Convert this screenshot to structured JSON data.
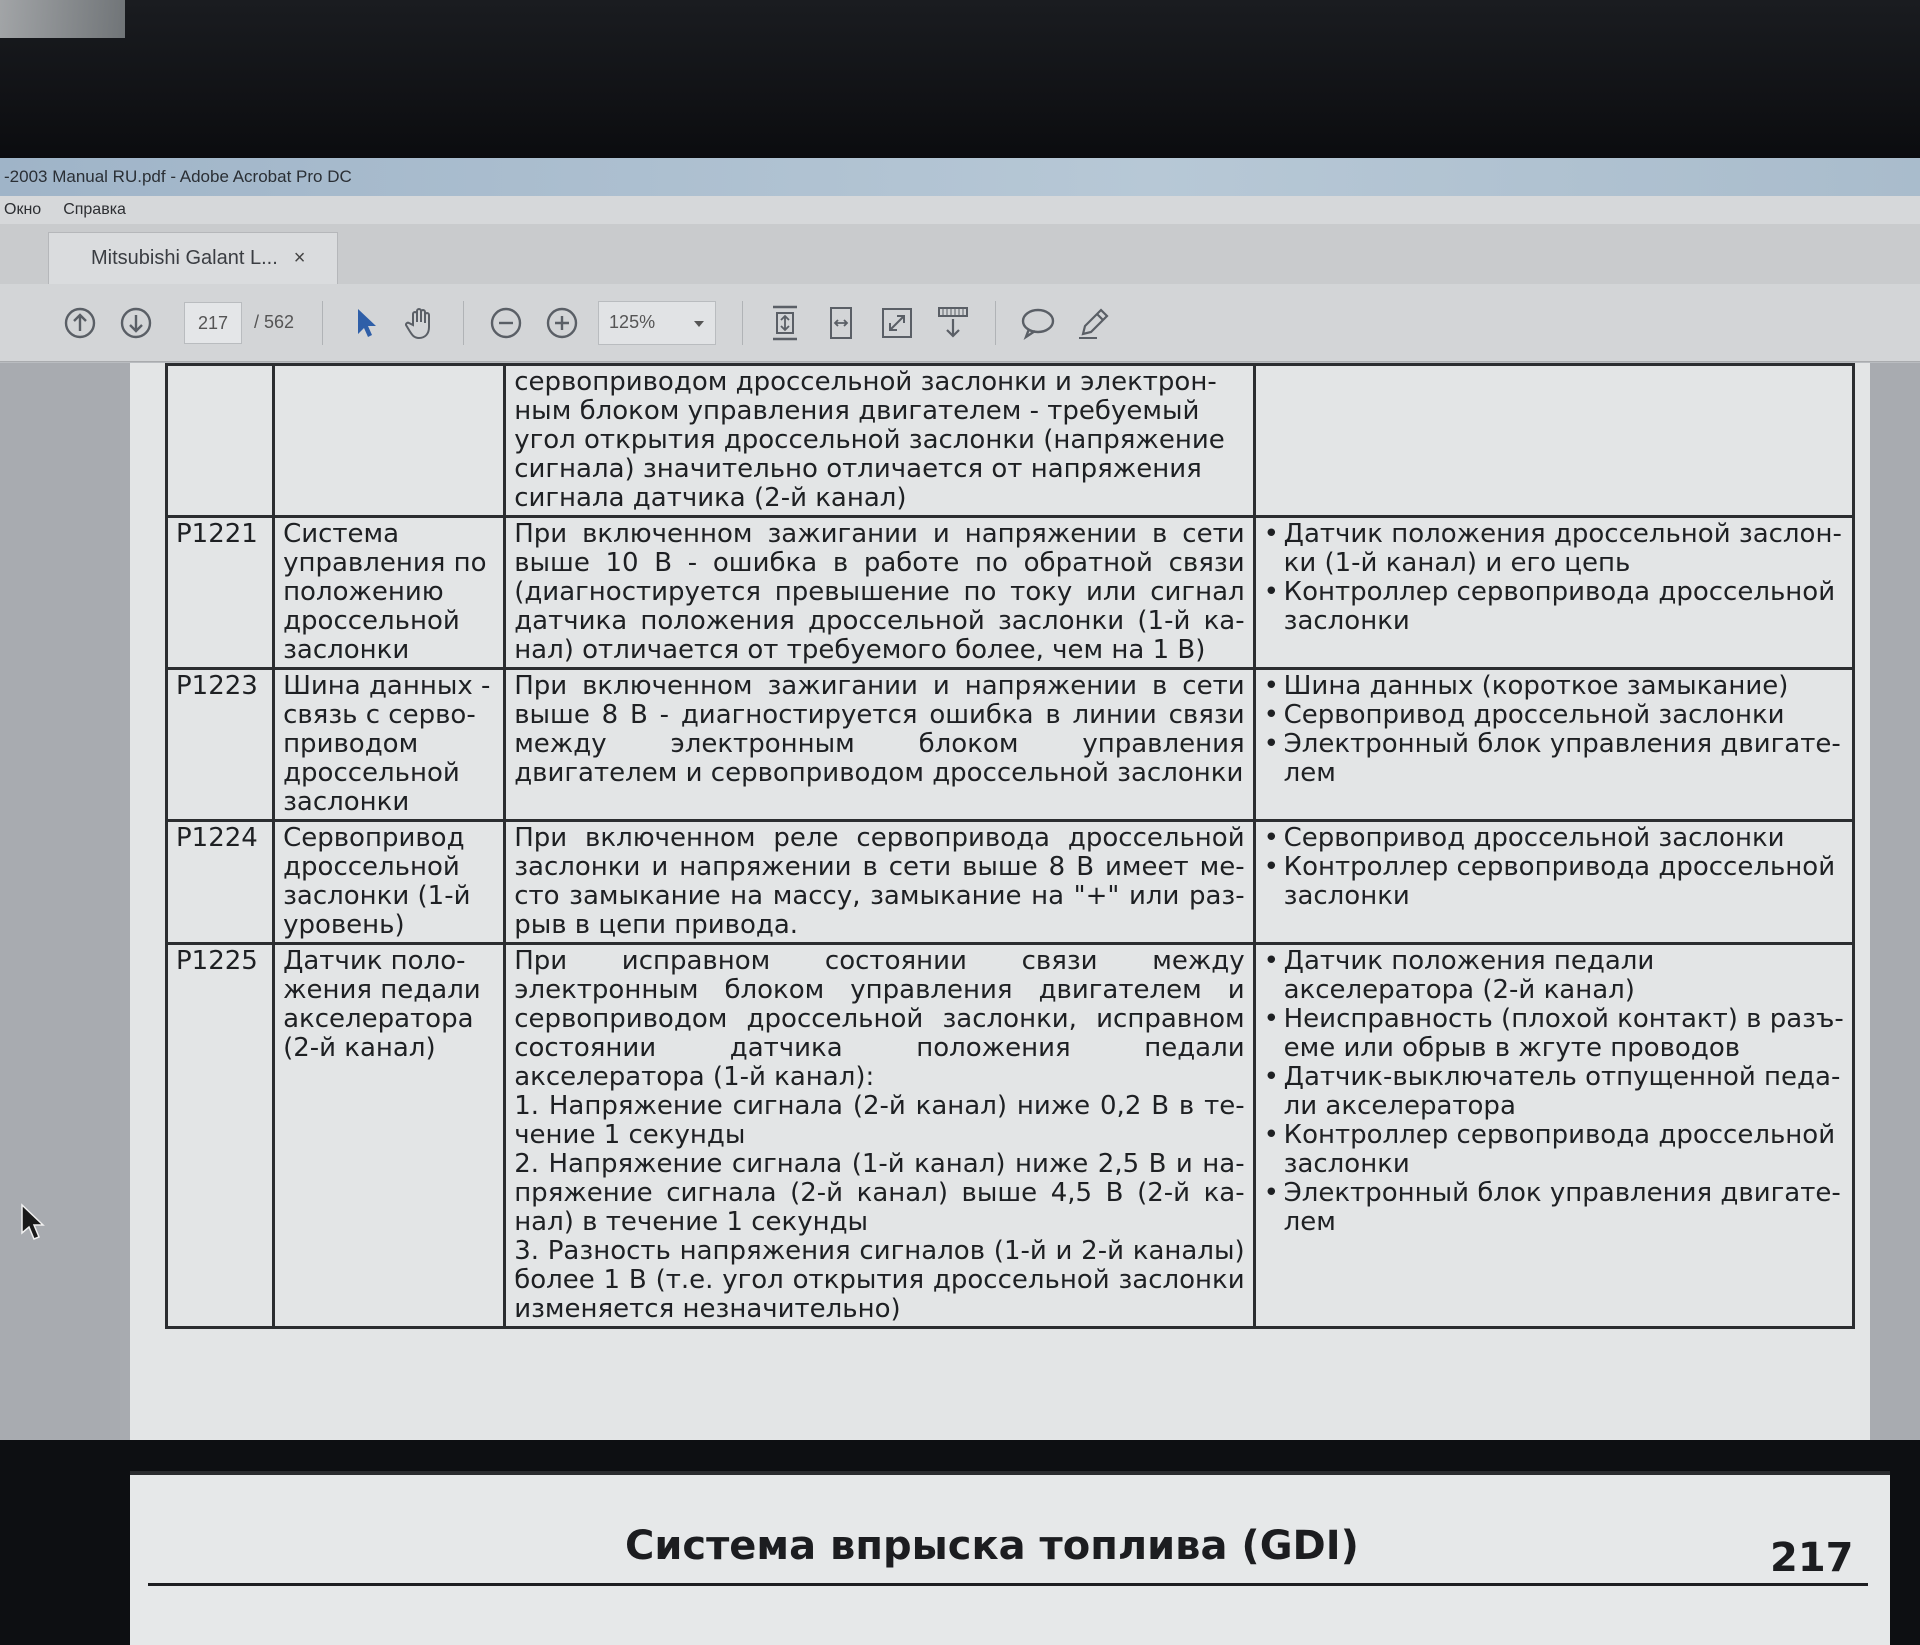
{
  "window": {
    "title": "-2003 Manual RU.pdf - Adobe Acrobat Pro DC"
  },
  "menu": {
    "items": [
      "Окно",
      "Справка"
    ]
  },
  "tab": {
    "label": "Mitsubishi Galant L...",
    "close": "×"
  },
  "toolbar": {
    "page_current": "217",
    "page_total": "/ 562",
    "zoom": "125%",
    "icons": [
      "arrow-up-circle-icon",
      "arrow-down-circle-icon",
      "select-arrow-icon",
      "hand-icon",
      "zoom-out-icon",
      "zoom-in-icon",
      "fit-page-icon",
      "fit-width-icon",
      "fullscreen-icon",
      "scroll-mode-icon",
      "comment-icon",
      "pen-icon"
    ]
  },
  "table": {
    "rows": [
      {
        "code": "",
        "name": "",
        "desc": [
          "сервоприводом дроссельной заслонки и электрон-",
          "ным блоком управления двигателем - требуемый",
          "угол открытия дроссельной заслонки (напряжение",
          "сигнала) значительно отличается от напряжения",
          "сигнала датчика (2-й канал)"
        ],
        "causes": []
      },
      {
        "code": "P1221",
        "name": "Система управления по положению дроссельной заслонки",
        "desc": [
          "При включенном зажигании и напряжении в сети выше 10 В - ошибка в работе по обратной связи (диагностируется превышение по току или сигнал датчика положения дроссельной заслонки (1-й ка-нал) отличается от требуемого более, чем на 1 В)"
        ],
        "causes": [
          "Датчик положения дроссельной заслон-ки (1-й канал) и его цепь",
          "Контроллер сервопривода дроссельной заслонки"
        ]
      },
      {
        "code": "P1223",
        "name": "Шина данных - связь с серво-приводом дроссельной заслонки",
        "desc": [
          "При включенном зажигании и напряжении в сети выше 8 В - диагностируется ошибка в линии связи между электронным блоком управления двигателем и сервоприводом дроссельной заслонки"
        ],
        "causes": [
          "Шина данных (короткое замыкание)",
          "Сервопривод дроссельной заслонки",
          "Электронный блок управления двигате-лем"
        ]
      },
      {
        "code": "P1224",
        "name": "Сервопривод дроссельной заслонки (1-й уровень)",
        "desc": [
          "При включенном реле сервопривода дроссельной заслонки и напряжении в сети выше 8 В имеет ме-сто замыкание на массу, замыкание на \"+\" или раз-рыв в цепи привода."
        ],
        "causes": [
          "Сервопривод дроссельной заслонки",
          "Контроллер сервопривода дроссельной заслонки"
        ]
      },
      {
        "code": "P1225",
        "name": "Датчик поло-жения педали акселератора (2-й канал)",
        "desc": [
          "При исправном состоянии связи между электронным блоком управления двигателем и сервоприводом дроссельной заслонки, исправном состоянии датчика положения педали акселератора (1-й канал):",
          "1. Напряжение сигнала (2-й канал) ниже 0,2 В в те-чение 1 секунды",
          "2. Напряжение сигнала (1-й канал) ниже 2,5 В и на-пряжение сигнала (2-й канал) выше 4,5 В (2-й ка-нал) в течение 1 секунды",
          "3. Разность напряжения сигналов (1-й и 2-й каналы) более 1 В (т.е. угол открытия дроссельной заслонки изменяется незначительно)"
        ],
        "causes": [
          "Датчик положения педали акселератора (2-й канал)",
          "Неисправность (плохой контакт) в разъ-еме или обрыв в жгуте проводов",
          "Датчик-выключатель отпущенной педа-ли акселератора",
          "Контроллер сервопривода дроссельной заслонки",
          "Электронный блок управления двигате-лем"
        ]
      }
    ]
  },
  "footer": {
    "title": "Система впрыска топлива (GDI)",
    "page_number": "217"
  }
}
